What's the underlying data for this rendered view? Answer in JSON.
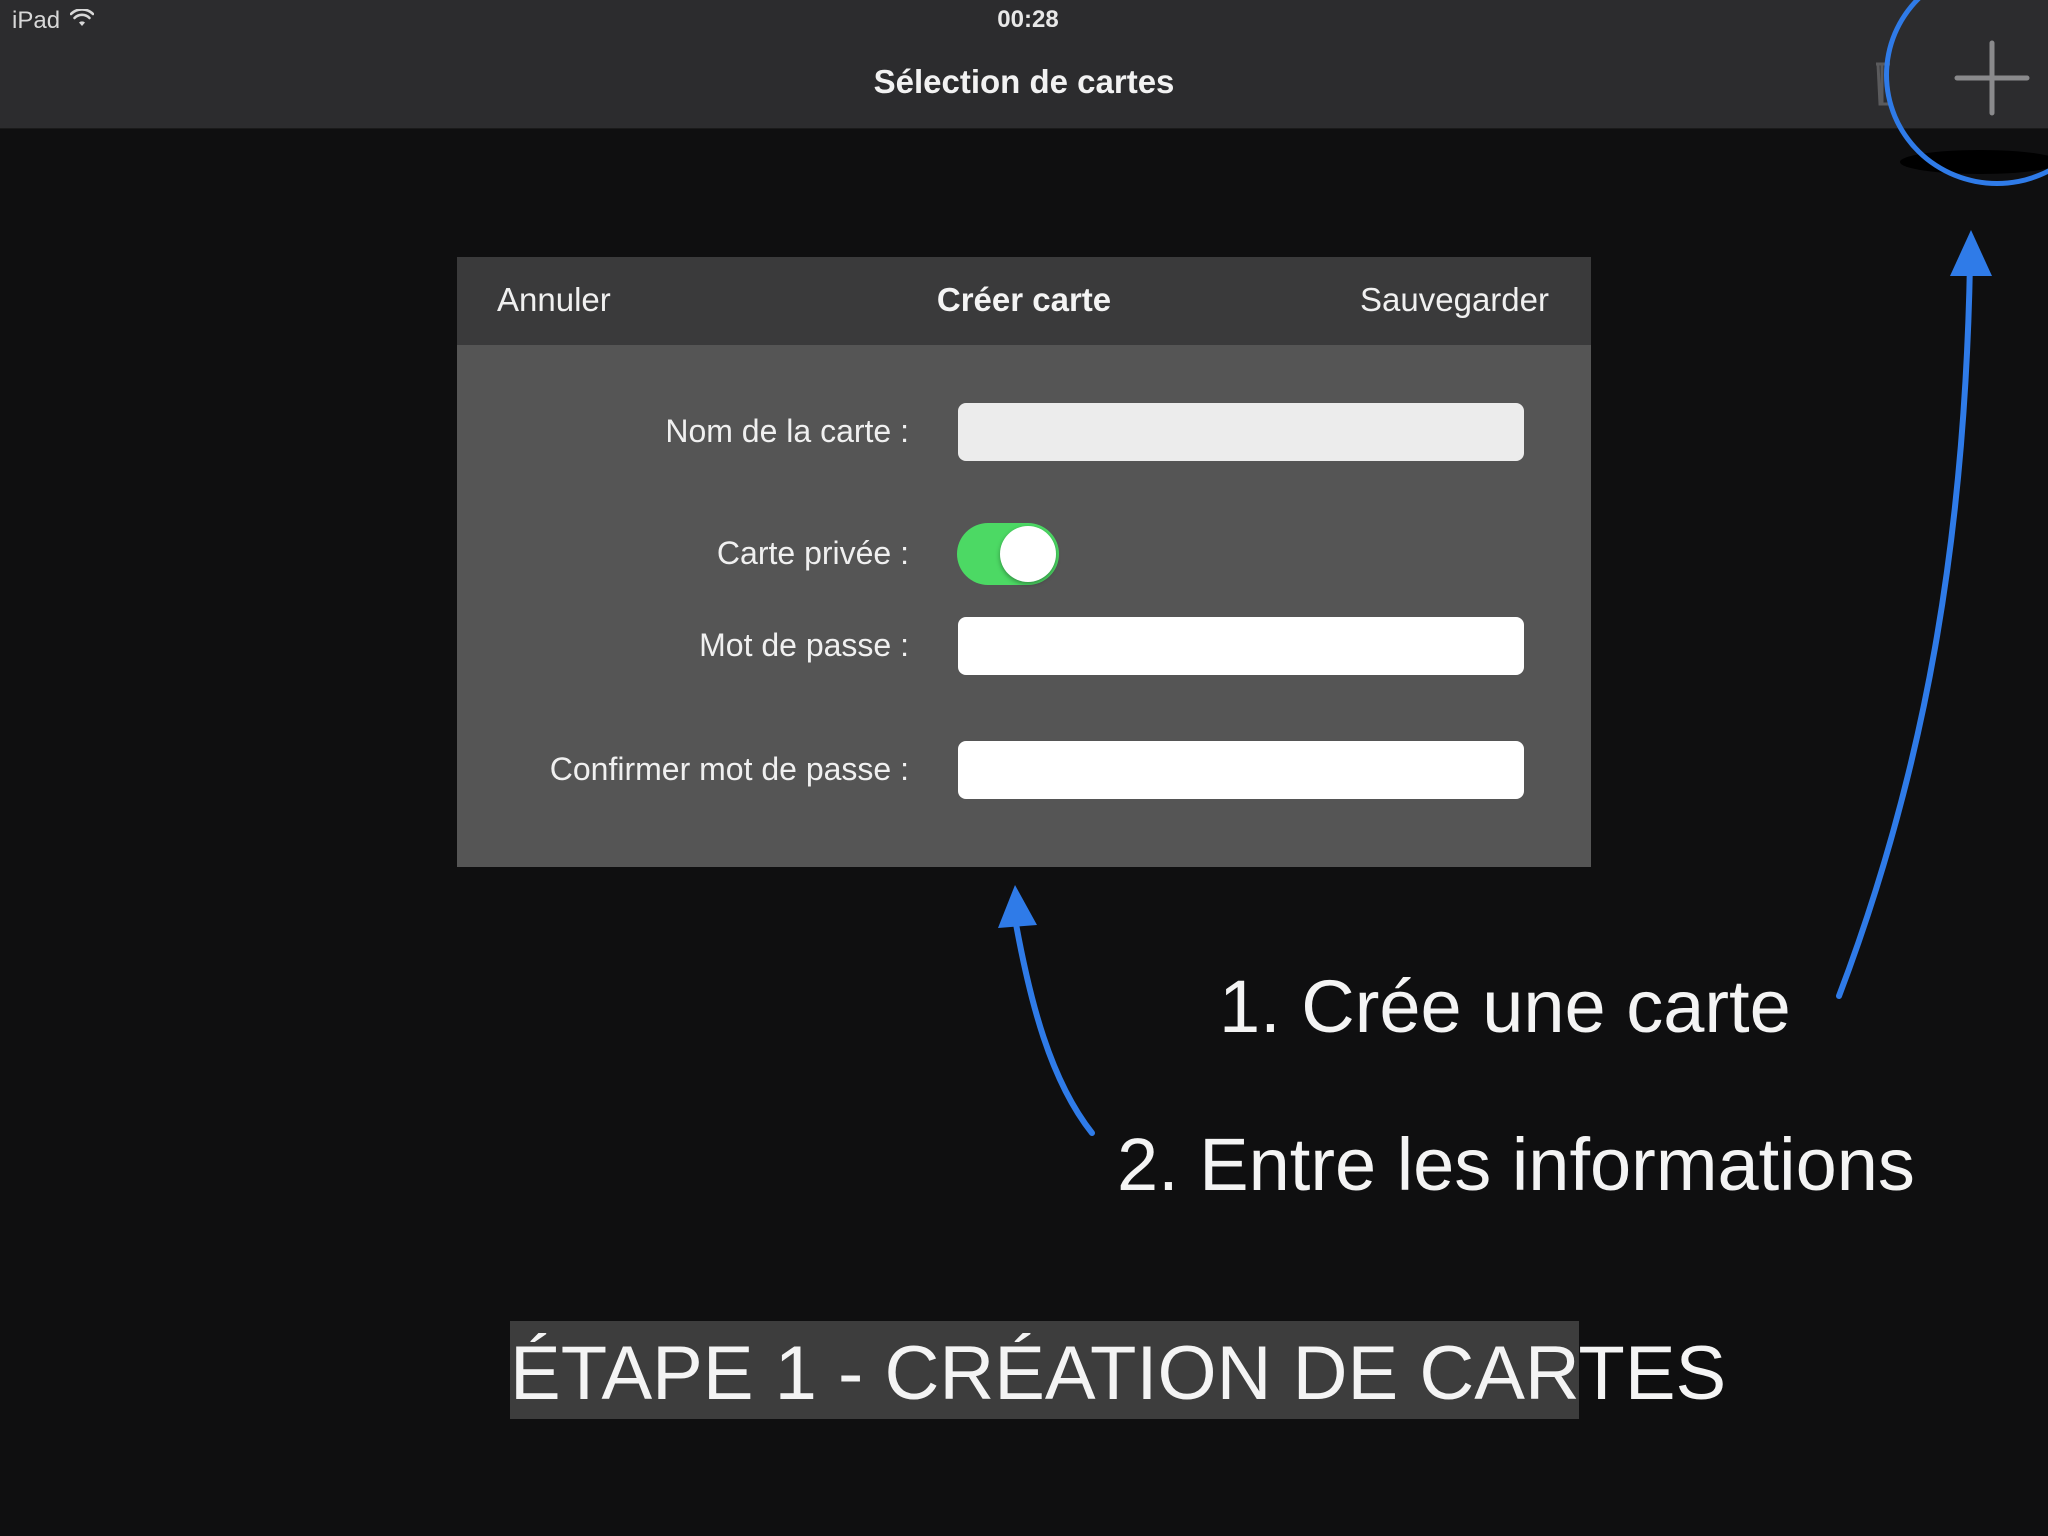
{
  "status_bar": {
    "device": "iPad",
    "time": "00:28"
  },
  "nav": {
    "title": "Sélection de cartes"
  },
  "dialog": {
    "cancel": "Annuler",
    "title": "Créer carte",
    "save": "Sauvegarder",
    "fields": {
      "name_label": "Nom de la carte :",
      "name_value": "",
      "private_label": "Carte privée :",
      "private_on": true,
      "password_label": "Mot de passe :",
      "password_value": "",
      "confirm_label": "Confirmer mot de passe :",
      "confirm_value": ""
    }
  },
  "annotations": {
    "step1": "1. Crée une carte",
    "step2": "2. Entre les informations",
    "caption": "ÉTAPE 1 - CRÉATION DE CARTES"
  },
  "colors": {
    "annotation_blue": "#2f7be8",
    "toggle_on": "#4cd964"
  },
  "icons": [
    "wifi-icon",
    "trash-icon",
    "plus-icon"
  ]
}
